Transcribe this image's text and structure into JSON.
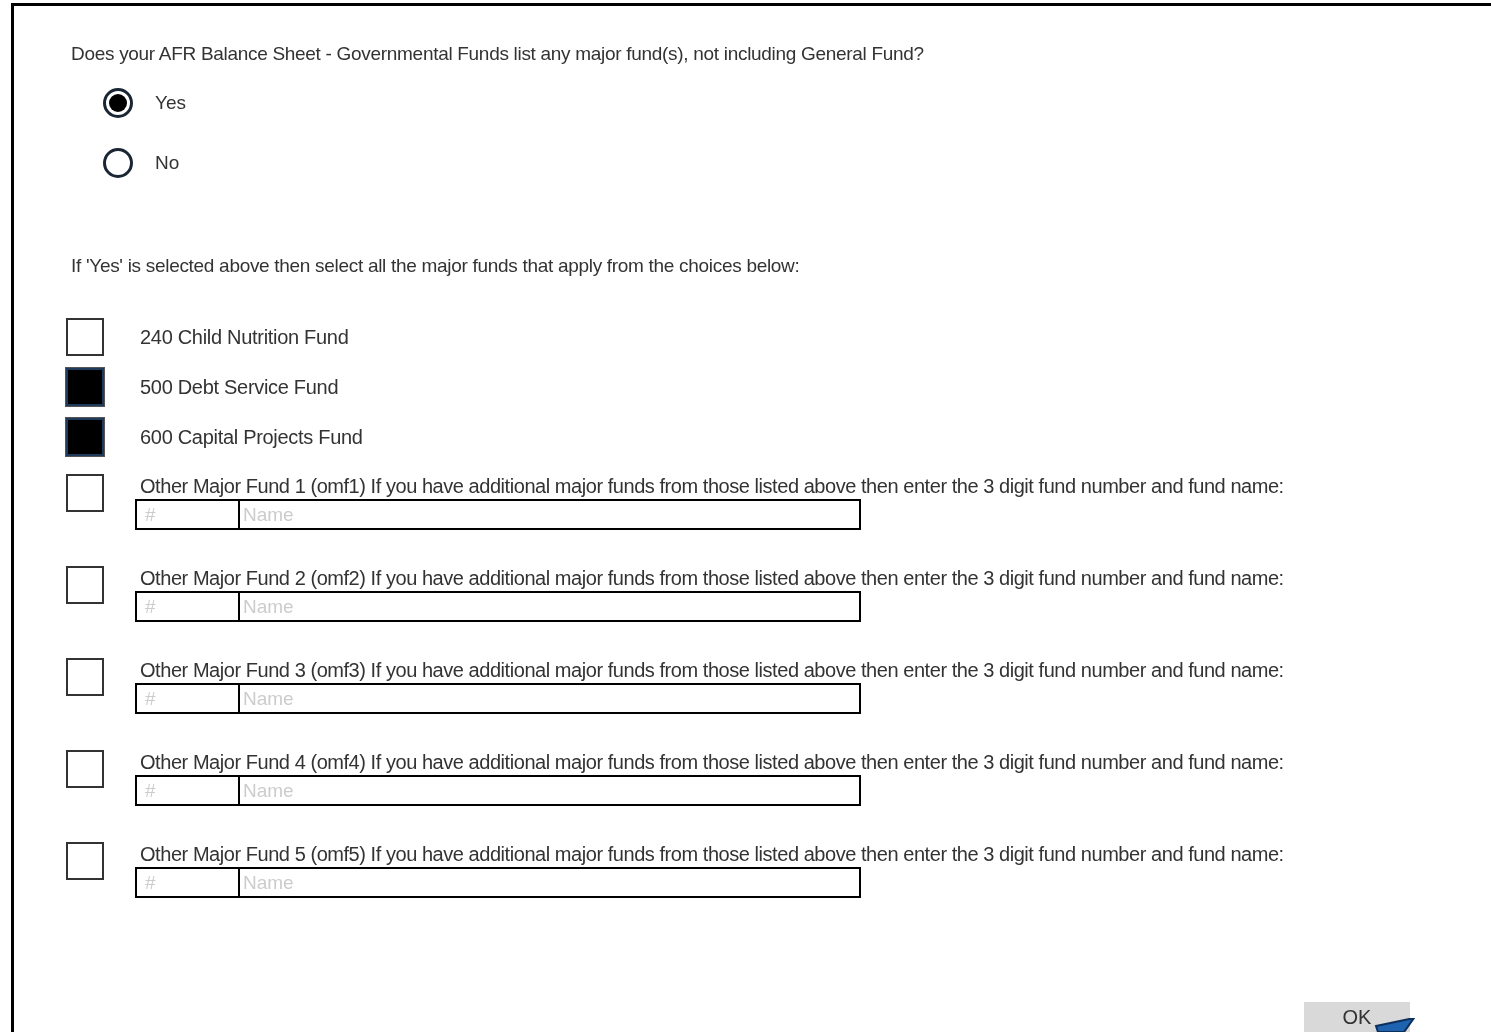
{
  "question": "Does your AFR Balance Sheet - Governmental Funds list any major fund(s), not including General Fund?",
  "options": [
    {
      "label": "Yes",
      "selected": true
    },
    {
      "label": "No",
      "selected": false
    }
  ],
  "instruction": "If 'Yes' is selected above then select all the major funds that apply from the choices below:",
  "funds": [
    {
      "kind": "simple",
      "label": "240 Child Nutrition Fund",
      "checked": false
    },
    {
      "kind": "simple",
      "label": "500 Debt Service Fund",
      "checked": true
    },
    {
      "kind": "simple",
      "label": "600 Capital Projects Fund",
      "checked": true
    },
    {
      "kind": "other",
      "label": "Other Major Fund 1 (omf1) If you have additional major funds from those listed above then enter the 3 digit fund number and fund name:",
      "checked": false,
      "number_placeholder": "#",
      "name_placeholder": "Name"
    },
    {
      "kind": "other",
      "label": "Other Major Fund 2 (omf2) If you have additional major funds from those listed above then enter the 3 digit fund number and fund name:",
      "checked": false,
      "number_placeholder": "#",
      "name_placeholder": "Name"
    },
    {
      "kind": "other",
      "label": "Other Major Fund 3 (omf3) If you have additional major funds from those listed above then enter the 3 digit fund number and fund name:",
      "checked": false,
      "number_placeholder": "#",
      "name_placeholder": "Name"
    },
    {
      "kind": "other",
      "label": "Other Major Fund 4 (omf4) If you have additional major funds from those listed above then enter the 3 digit fund number and fund name:",
      "checked": false,
      "number_placeholder": "#",
      "name_placeholder": "Name"
    },
    {
      "kind": "other",
      "label": "Other Major Fund 5 (omf5) If you have additional major funds from those listed above then enter the 3 digit fund number and fund name:",
      "checked": false,
      "number_placeholder": "#",
      "name_placeholder": "Name"
    }
  ],
  "ok_button": "OK"
}
